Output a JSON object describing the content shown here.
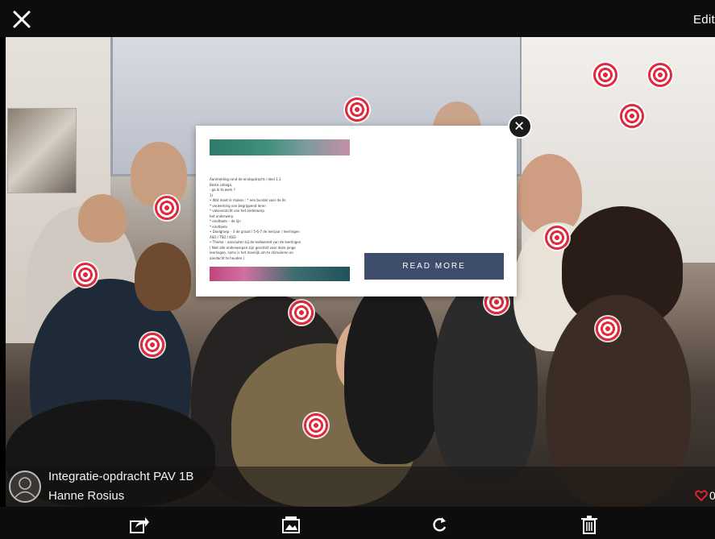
{
  "header": {
    "edit_label": "Edit",
    "close_icon": "close-icon"
  },
  "popup": {
    "read_more_label": "READ MORE",
    "close_icon": "close-icon",
    "document_preview_lines": [
      "Aanmelding rond de eindopdracht / deel 1.1",
      "Beste collega,",
      "· ga ik te werk ?",
      "1)",
      "• Wat moet ik maken : * een bundel voor de lln",
      "* verwerking van begrippend leren",
      "* vakoverzicht van het onderwerp",
      "het onderwerp",
      "* eindtoets – de lijn",
      "* eindtoets",
      "• Doelgroep – 3 de graad / 5-6-7 de leerjaar / leerlingen",
      "ASO / TSO / KSO",
      "• Thema – aansluiten bij de leefwereld van de leerlingen",
      "( Niet alle onderwerpen zijn geschikt voor deze jonge",
      "leerlingen, soms is het moeilijk om te stimuleren en",
      "aandacht te houden.)"
    ]
  },
  "post": {
    "title": "Integratie-opdracht PAV 1B",
    "author": "Hanne Rosius",
    "likes": "0"
  },
  "toolbar": {
    "icons": [
      "share-icon",
      "gallery-icon",
      "refresh-icon",
      "trash-icon"
    ]
  },
  "colors": {
    "target_red": "#e02a3e",
    "button_blue": "#3d4d6b",
    "heart_red": "#e0202c",
    "bar_black": "#0d0d0d"
  }
}
